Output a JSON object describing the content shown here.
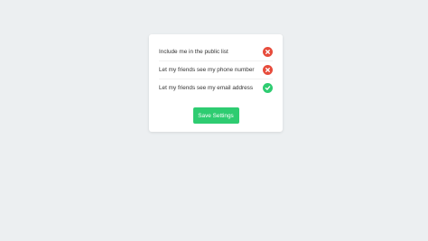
{
  "settings": {
    "items": [
      {
        "label": "Include me in the public list",
        "status_icon": "x-circle-icon",
        "enabled": false
      },
      {
        "label": "Let my friends see my phone number",
        "status_icon": "x-circle-icon",
        "enabled": false
      },
      {
        "label": "Let my friends see my email address",
        "status_icon": "check-circle-icon",
        "enabled": true
      }
    ],
    "save_label": "Save Settings"
  },
  "colors": {
    "background": "#eceff1",
    "card": "#ffffff",
    "off": "#e74c3c",
    "on": "#2ecc71",
    "text": "#333333"
  }
}
